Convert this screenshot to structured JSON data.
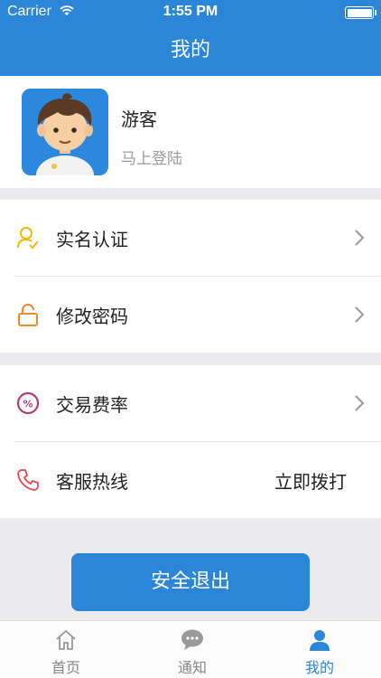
{
  "status_bar": {
    "carrier": "Carrier",
    "time": "1:55 PM"
  },
  "nav": {
    "title": "我的"
  },
  "profile": {
    "name": "游客",
    "login_prompt": "马上登陆"
  },
  "menu_group1": [
    {
      "icon": "user-verify-icon",
      "label": "实名认证"
    },
    {
      "icon": "lock-icon",
      "label": "修改密码"
    }
  ],
  "menu_group2": [
    {
      "icon": "percent-icon",
      "label": "交易费率"
    },
    {
      "icon": "phone-icon",
      "label": "客服热线",
      "action": "立即拨打"
    }
  ],
  "logout": {
    "label": "安全退出"
  },
  "tabs": [
    {
      "icon": "home-icon",
      "label": "首页",
      "active": false
    },
    {
      "icon": "chat-bubble-icon",
      "label": "通知",
      "active": false
    },
    {
      "icon": "person-icon",
      "label": "我的",
      "active": true
    }
  ],
  "colors": {
    "primary": "#2c86d8",
    "background": "#ebebed"
  }
}
